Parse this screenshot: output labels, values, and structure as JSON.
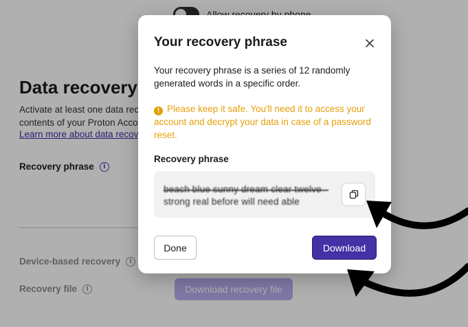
{
  "background": {
    "toggle_label": "Allow recovery by phone",
    "section_title": "Data recovery",
    "section_desc": "Activate at least one data recovery method to make sure you can continue to access the contents of your Proton Account if you lose your password.",
    "learn_link": "Learn more about data recovery",
    "recovery_phrase_label": "Recovery phrase",
    "device_recovery_label": "Device-based recovery",
    "recovery_file_label": "Recovery file",
    "download_file_button": "Download recovery file"
  },
  "modal": {
    "title": "Your recovery phrase",
    "description": "Your recovery phrase is a series of 12 randomly generated words in a specific order.",
    "warning": "Please keep it safe. You'll need it to access your account and decrypt your data in case of a password reset.",
    "phrase_label": "Recovery phrase",
    "phrase_value": "beach blue sunny dream clear twelve strong real before will need able",
    "done_label": "Done",
    "download_label": "Download"
  },
  "colors": {
    "accent": "#4530a6",
    "warning": "#e49f08"
  },
  "icons": {
    "close": "close-icon",
    "copy": "copy-icon",
    "warning": "warning-icon",
    "info": "info-icon"
  }
}
